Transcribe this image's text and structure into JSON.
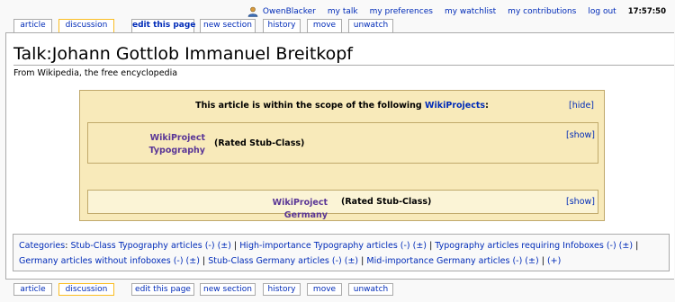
{
  "personal_tools": {
    "user": "OwenBlacker",
    "my_talk": "my talk",
    "my_preferences": "my preferences",
    "my_watchlist": "my watchlist",
    "my_contributions": "my contributions",
    "log_out": "log out",
    "time": "17:57:50"
  },
  "tabs": {
    "article": "article",
    "discussion": "discussion",
    "edit": "edit this page",
    "new_section": "new section",
    "history": "history",
    "move": "move",
    "unwatch": "unwatch"
  },
  "page": {
    "title": "Talk:Johann Gottlob Immanuel Breitkopf",
    "subtitle": "From Wikipedia, the free encyclopedia"
  },
  "banner": {
    "heading_prefix": "This article is within the scope of the following",
    "heading_link": "WikiProjects",
    "heading_suffix": ":",
    "hide": "[hide]",
    "projects": [
      {
        "name_line1": "WikiProject",
        "name_line2": "Typography",
        "rating": "(Rated Stub-Class)",
        "show": "[show]"
      },
      {
        "name": "WikiProject Germany",
        "rating": "(Rated Stub-Class)",
        "show": "[show]"
      }
    ]
  },
  "categories": {
    "label": "Categories",
    "items": [
      "Stub-Class Typography articles (-) (±)",
      "High-importance Typography articles (-) (±)",
      "Typography articles requiring Infoboxes (-) (±)",
      "Germany articles without infoboxes (-) (±)",
      "Stub-Class Germany articles (-) (±)",
      "Mid-importance Germany articles (-) (±)",
      "(+)"
    ]
  },
  "colors": {
    "link": "#002bb8",
    "banner_bg": "#f8eaba",
    "banner_border": "#c0a96b",
    "project_link": "#5a3696",
    "selected_tab_border": "#fabd23"
  }
}
